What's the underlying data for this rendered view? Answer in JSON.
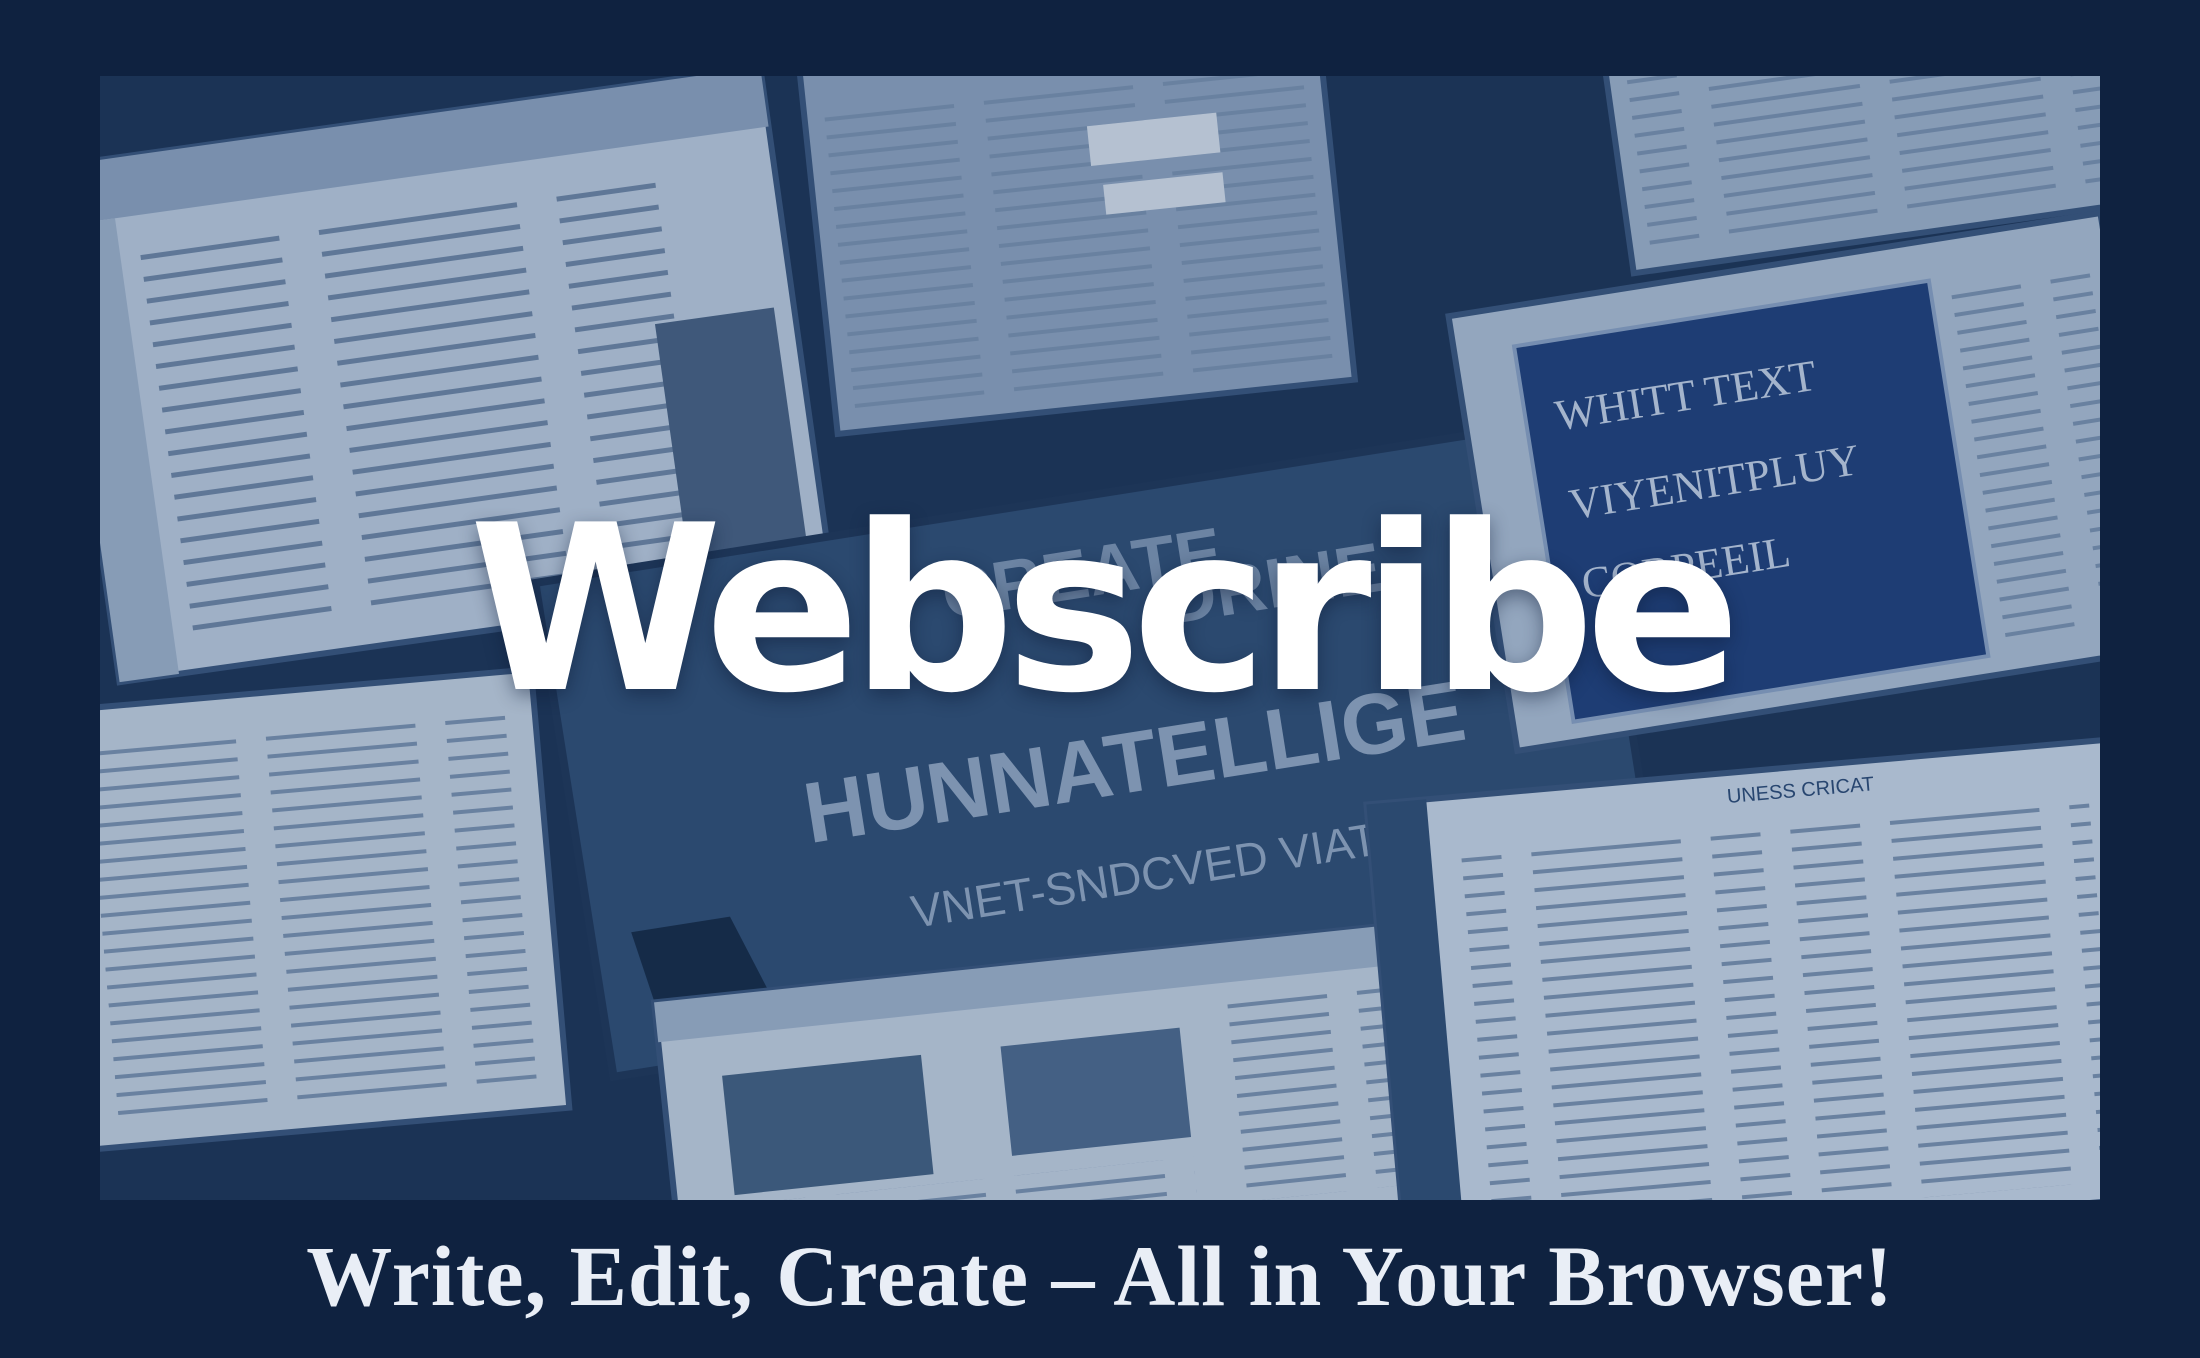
{
  "hero": {
    "brand_name": "Webscribe",
    "collage_texts": {
      "center_heading_1": "CREATE",
      "center_heading_2": "DRINE",
      "center_heading_3": "HUNNATELLIGE",
      "center_subline": "VNET-SNDCVED VIATER",
      "right_heading_1": "WHITT TEXT",
      "right_heading_2": "VIYENITPLUY",
      "right_heading_3": "CORPEEIL",
      "bottom_right_title": "UNESS CRICAT"
    }
  },
  "tagline": "Write, Edit, Create – All in Your Browser!",
  "colors": {
    "page_bg": "#0f2240",
    "panel_bg": "#c9d6e4",
    "panel_frame": "#3d5878",
    "accent": "#2b4a73",
    "brand_text": "#ffffff"
  }
}
